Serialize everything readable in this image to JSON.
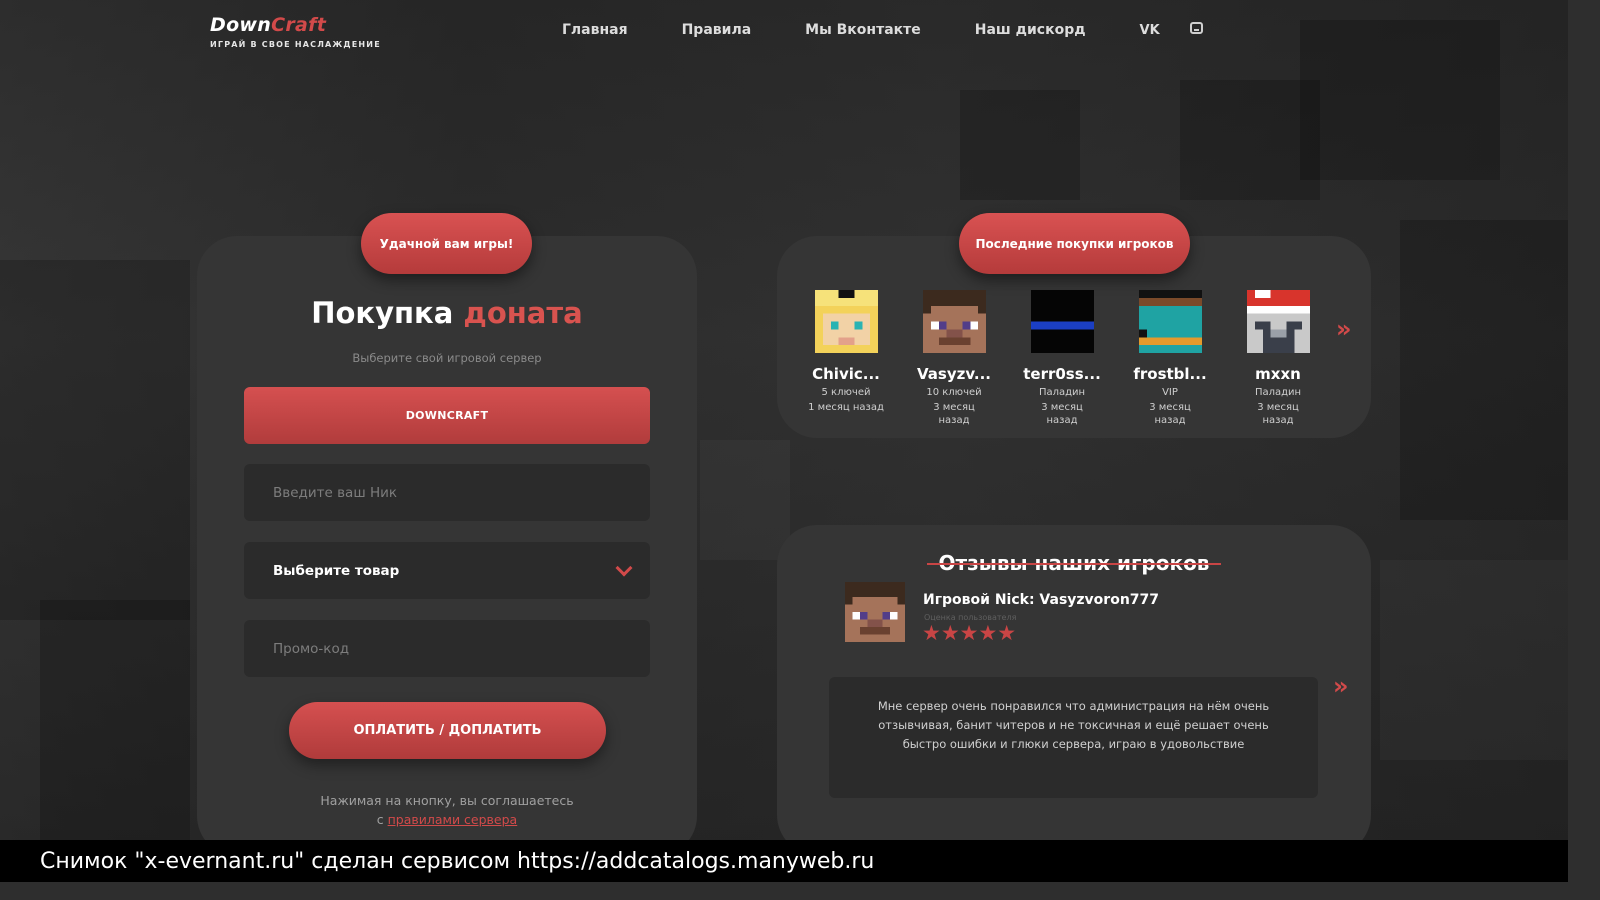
{
  "logo": {
    "part1": "Down",
    "part2": "Craft",
    "tagline": "ИГРАЙ В СВОЕ НАСЛАЖДЕНИЕ"
  },
  "nav": {
    "items": [
      "Главная",
      "Правила",
      "Мы Вконтакте",
      "Наш дискорд"
    ],
    "vk_label": "VK",
    "icons": [
      "vk-icon",
      "discord-icon"
    ]
  },
  "shop": {
    "badge": "Удачной вам игры!",
    "title_part1": "Покупка",
    "title_part2": "доната",
    "server_hint": "Выберите свой игровой сервер",
    "server_button": "DOWNCRAFT",
    "nick_placeholder": "Введите ваш Ник",
    "product_select": "Выберите товар",
    "promo_placeholder": "Промо-код",
    "pay_button": "ОПЛАТИТЬ / ДОПЛАТИТЬ",
    "agree_text": "Нажимая на кнопку, вы соглашаетесь",
    "agree_prefix": "с",
    "agree_link": "правилами сервера"
  },
  "recent": {
    "badge": "Последние покупки игроков",
    "buyers": [
      {
        "name": "Chivic...",
        "item": "5 ключей",
        "time": "1 месяц назад"
      },
      {
        "name": "Vasyzv...",
        "item": "10 ключей",
        "time": "3 месяц назад"
      },
      {
        "name": "terr0ss...",
        "item": "Паладин",
        "time": "3 месяц назад"
      },
      {
        "name": "frostbl...",
        "item": "VIP",
        "time": "3 месяц назад"
      },
      {
        "name": "mxxn",
        "item": "Паладин",
        "time": "3 месяц назад"
      }
    ],
    "next_icon": "double-chevron-right-icon"
  },
  "reviews": {
    "title": "Отзывы наших игроков",
    "nick": "Игровой Nick: Vasyzvoron777",
    "rating_label": "Оценка пользователя",
    "stars": "★★★★★",
    "rating": 5,
    "text": "Мне сервер очень понравился что администрация на нём очень отзывчивая, банит читеров и не токсичная и ещё решает очень быстро ошибки и глюки сервера, играю в удовольствие",
    "next_icon": "double-chevron-right-icon"
  },
  "footer": {
    "caption": "Снимок \"x-evernant.ru\" сделан сервисом https://addcatalogs.manyweb.ru"
  },
  "colors": {
    "accent": "#d24a4a",
    "panel": "#353535",
    "field": "#2b2b2b",
    "page": "#2e2e2e"
  }
}
